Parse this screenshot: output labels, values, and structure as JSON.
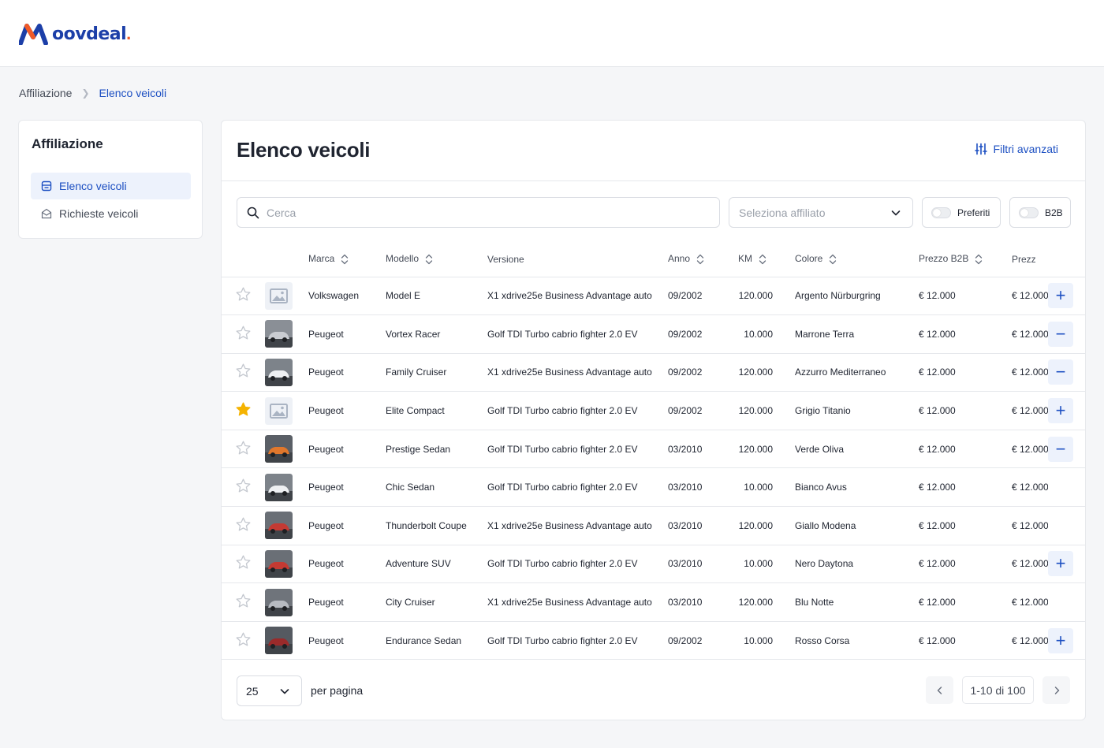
{
  "brand": {
    "name": "oovdeal",
    "dot": ".",
    "accent": "#1c3fa8",
    "dot_color": "#f05a28"
  },
  "breadcrumb": {
    "items": [
      "Affiliazione",
      "Elenco veicoli"
    ]
  },
  "sidebar": {
    "title": "Affiliazione",
    "items": [
      {
        "label": "Elenco veicoli",
        "icon": "list-icon",
        "active": true
      },
      {
        "label": "Richieste veicoli",
        "icon": "mail-icon",
        "active": false
      }
    ]
  },
  "main": {
    "title": "Elenco veicoli",
    "advanced_filters_label": "Filtri avanzati",
    "search_placeholder": "Cerca",
    "affiliate_select_placeholder": "Seleziona affiliato",
    "toggles": {
      "preferiti": "Preferiti",
      "b2b": "B2B"
    }
  },
  "table": {
    "columns": [
      "Marca",
      "Modello",
      "Versione",
      "Anno",
      "KM",
      "Colore",
      "Prezzo B2B",
      "Prezz"
    ],
    "rows": [
      {
        "favorite": false,
        "thumb": "placeholder",
        "marca": "Volkswagen",
        "modello": "Model E",
        "versione": "X1 xdrive25e Business Advantage auto",
        "anno": "09/2002",
        "km": "120.000",
        "colore": "Argento Nürburgring",
        "prezzo_b2b": "€ 12.000",
        "prezzo": "€ 12.000",
        "action": "+"
      },
      {
        "favorite": false,
        "thumb": "silver",
        "marca": "Peugeot",
        "modello": "Vortex Racer",
        "versione": "Golf TDI Turbo cabrio fighter 2.0 EV",
        "anno": "09/2002",
        "km": "10.000",
        "colore": "Marrone Terra",
        "prezzo_b2b": "€ 12.000",
        "prezzo": "€ 12.000",
        "action": "−"
      },
      {
        "favorite": false,
        "thumb": "white",
        "marca": "Peugeot",
        "modello": "Family Cruiser",
        "versione": "X1 xdrive25e Business Advantage auto",
        "anno": "09/2002",
        "km": "120.000",
        "colore": "Azzurro Mediterraneo",
        "prezzo_b2b": "€ 12.000",
        "prezzo": "€ 12.000",
        "action": "−"
      },
      {
        "favorite": true,
        "thumb": "placeholder",
        "marca": "Peugeot",
        "modello": "Elite Compact",
        "versione": "Golf TDI Turbo cabrio fighter 2.0 EV",
        "anno": "09/2002",
        "km": "120.000",
        "colore": "Grigio Titanio",
        "prezzo_b2b": "€ 12.000",
        "prezzo": "€ 12.000",
        "action": "+"
      },
      {
        "favorite": false,
        "thumb": "orange",
        "marca": "Peugeot",
        "modello": "Prestige Sedan",
        "versione": "Golf TDI Turbo cabrio fighter 2.0 EV",
        "anno": "03/2010",
        "km": "120.000",
        "colore": "Verde Oliva",
        "prezzo_b2b": "€ 12.000",
        "prezzo": "€ 12.000",
        "action": "−"
      },
      {
        "favorite": false,
        "thumb": "white",
        "marca": "Peugeot",
        "modello": "Chic Sedan",
        "versione": "Golf TDI Turbo cabrio fighter 2.0 EV",
        "anno": "03/2010",
        "km": "10.000",
        "colore": "Bianco Avus",
        "prezzo_b2b": "€ 12.000",
        "prezzo": "€ 12.000",
        "action": ""
      },
      {
        "favorite": false,
        "thumb": "red",
        "marca": "Peugeot",
        "modello": "Thunderbolt Coupe",
        "versione": "X1 xdrive25e Business Advantage auto",
        "anno": "03/2010",
        "km": "120.000",
        "colore": "Giallo Modena",
        "prezzo_b2b": "€ 12.000",
        "prezzo": "€ 12.000",
        "action": ""
      },
      {
        "favorite": false,
        "thumb": "red",
        "marca": "Peugeot",
        "modello": "Adventure SUV",
        "versione": "Golf TDI Turbo cabrio fighter 2.0 EV",
        "anno": "03/2010",
        "km": "10.000",
        "colore": "Nero Daytona",
        "prezzo_b2b": "€ 12.000",
        "prezzo": "€ 12.000",
        "action": "+"
      },
      {
        "favorite": false,
        "thumb": "grey",
        "marca": "Peugeot",
        "modello": "City Cruiser",
        "versione": "X1 xdrive25e Business Advantage auto",
        "anno": "03/2010",
        "km": "120.000",
        "colore": "Blu Notte",
        "prezzo_b2b": "€ 12.000",
        "prezzo": "€ 12.000",
        "action": ""
      },
      {
        "favorite": false,
        "thumb": "dark",
        "marca": "Peugeot",
        "modello": "Endurance Sedan",
        "versione": "Golf TDI Turbo cabrio fighter 2.0 EV",
        "anno": "09/2002",
        "km": "10.000",
        "colore": "Rosso Corsa",
        "prezzo_b2b": "€ 12.000",
        "prezzo": "€ 12.000",
        "action": "+"
      }
    ]
  },
  "pagination": {
    "page_size": "25",
    "per_page_label": "per pagina",
    "range": "1-10 di 100"
  },
  "colors": {
    "primary": "#1c4fc2",
    "star_active": "#f5b301",
    "star_inactive": "#c4c8cf"
  }
}
